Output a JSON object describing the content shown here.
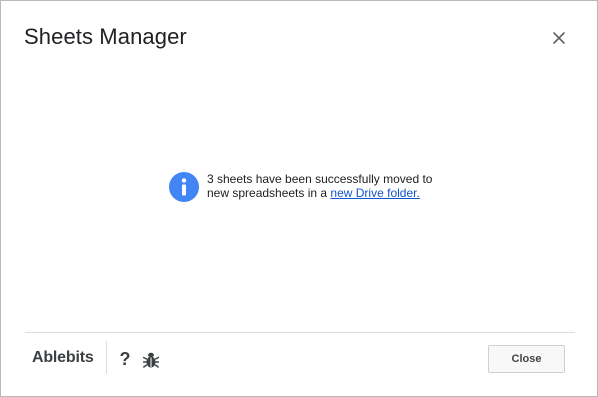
{
  "dialog": {
    "title": "Sheets Manager",
    "close_icon": "close-icon"
  },
  "message": {
    "icon": "info-icon",
    "text_before_link": "3 sheets have been successfully moved to new spreadsheets in a ",
    "link_text": "new Drive folder."
  },
  "footer": {
    "brand": "Ablebits",
    "help_label": "?",
    "bug_icon": "bug-icon",
    "close_button_label": "Close"
  },
  "colors": {
    "info_icon": "#4285f4",
    "link": "#1155cc"
  }
}
